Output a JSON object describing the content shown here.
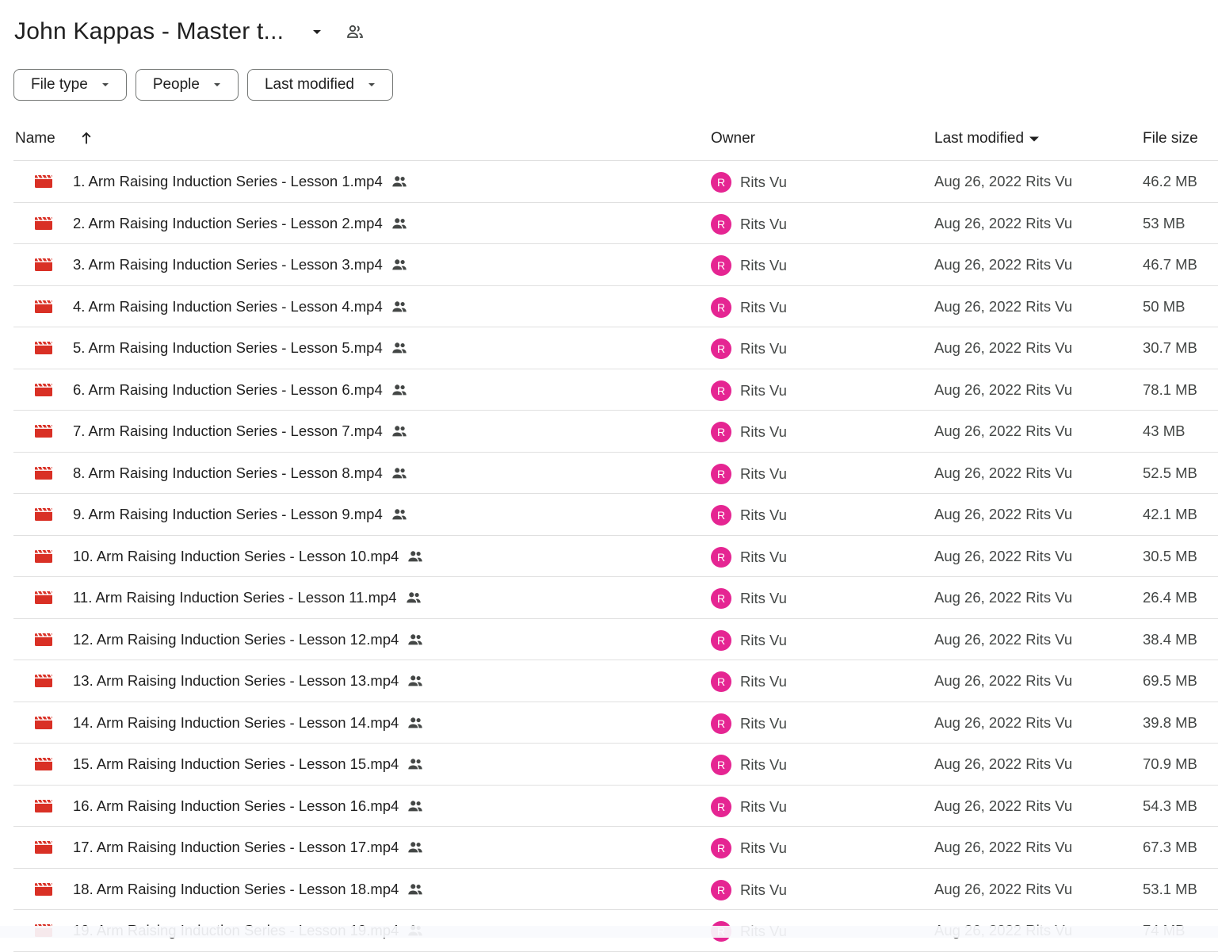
{
  "header": {
    "title": "John Kappas - Master t...",
    "caret_icon": "arrow-drop-down-icon",
    "share_icon": "shared-people-icon"
  },
  "filters": {
    "file_type": "File type",
    "people": "People",
    "last_modified": "Last modified"
  },
  "columns": {
    "name": "Name",
    "owner": "Owner",
    "last_modified": "Last modified",
    "file_size": "File size"
  },
  "colors": {
    "video_icon": "#d93025",
    "avatar": "#e52592",
    "border": "#e0e0e0"
  },
  "files": [
    {
      "name": "1. Arm Raising Induction Series - Lesson 1.mp4",
      "owner": "Rits Vu",
      "avatar": "R",
      "modified": "Aug 26, 2022 Rits Vu",
      "size": "46.2 MB"
    },
    {
      "name": "2. Arm Raising Induction Series - Lesson 2.mp4",
      "owner": "Rits Vu",
      "avatar": "R",
      "modified": "Aug 26, 2022 Rits Vu",
      "size": "53 MB"
    },
    {
      "name": "3. Arm Raising Induction Series - Lesson 3.mp4",
      "owner": "Rits Vu",
      "avatar": "R",
      "modified": "Aug 26, 2022 Rits Vu",
      "size": "46.7 MB"
    },
    {
      "name": "4. Arm Raising Induction Series - Lesson 4.mp4",
      "owner": "Rits Vu",
      "avatar": "R",
      "modified": "Aug 26, 2022 Rits Vu",
      "size": "50 MB"
    },
    {
      "name": "5. Arm Raising Induction Series - Lesson 5.mp4",
      "owner": "Rits Vu",
      "avatar": "R",
      "modified": "Aug 26, 2022 Rits Vu",
      "size": "30.7 MB"
    },
    {
      "name": "6. Arm Raising Induction Series - Lesson 6.mp4",
      "owner": "Rits Vu",
      "avatar": "R",
      "modified": "Aug 26, 2022 Rits Vu",
      "size": "78.1 MB"
    },
    {
      "name": "7. Arm Raising Induction Series - Lesson 7.mp4",
      "owner": "Rits Vu",
      "avatar": "R",
      "modified": "Aug 26, 2022 Rits Vu",
      "size": "43 MB"
    },
    {
      "name": "8. Arm Raising Induction Series - Lesson 8.mp4",
      "owner": "Rits Vu",
      "avatar": "R",
      "modified": "Aug 26, 2022 Rits Vu",
      "size": "52.5 MB"
    },
    {
      "name": "9. Arm Raising Induction Series - Lesson 9.mp4",
      "owner": "Rits Vu",
      "avatar": "R",
      "modified": "Aug 26, 2022 Rits Vu",
      "size": "42.1 MB"
    },
    {
      "name": "10. Arm Raising Induction Series - Lesson 10.mp4",
      "owner": "Rits Vu",
      "avatar": "R",
      "modified": "Aug 26, 2022 Rits Vu",
      "size": "30.5 MB"
    },
    {
      "name": "11. Arm Raising Induction Series - Lesson 11.mp4",
      "owner": "Rits Vu",
      "avatar": "R",
      "modified": "Aug 26, 2022 Rits Vu",
      "size": "26.4 MB"
    },
    {
      "name": "12. Arm Raising Induction Series - Lesson 12.mp4",
      "owner": "Rits Vu",
      "avatar": "R",
      "modified": "Aug 26, 2022 Rits Vu",
      "size": "38.4 MB"
    },
    {
      "name": "13. Arm Raising Induction Series - Lesson 13.mp4",
      "owner": "Rits Vu",
      "avatar": "R",
      "modified": "Aug 26, 2022 Rits Vu",
      "size": "69.5 MB"
    },
    {
      "name": "14. Arm Raising Induction Series - Lesson 14.mp4",
      "owner": "Rits Vu",
      "avatar": "R",
      "modified": "Aug 26, 2022 Rits Vu",
      "size": "39.8 MB"
    },
    {
      "name": "15. Arm Raising Induction Series - Lesson 15.mp4",
      "owner": "Rits Vu",
      "avatar": "R",
      "modified": "Aug 26, 2022 Rits Vu",
      "size": "70.9 MB"
    },
    {
      "name": "16. Arm Raising Induction Series - Lesson 16.mp4",
      "owner": "Rits Vu",
      "avatar": "R",
      "modified": "Aug 26, 2022 Rits Vu",
      "size": "54.3 MB"
    },
    {
      "name": "17. Arm Raising Induction Series - Lesson 17.mp4",
      "owner": "Rits Vu",
      "avatar": "R",
      "modified": "Aug 26, 2022 Rits Vu",
      "size": "67.3 MB"
    },
    {
      "name": "18. Arm Raising Induction Series - Lesson 18.mp4",
      "owner": "Rits Vu",
      "avatar": "R",
      "modified": "Aug 26, 2022 Rits Vu",
      "size": "53.1 MB"
    },
    {
      "name": "19. Arm Raising Induction Series - Lesson 19.mp4",
      "owner": "Rits Vu",
      "avatar": "R",
      "modified": "Aug 26, 2022 Rits Vu",
      "size": "74 MB"
    }
  ]
}
